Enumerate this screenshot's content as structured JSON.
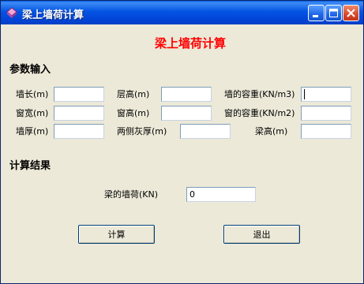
{
  "window": {
    "title": "梁上墙荷计算"
  },
  "heading": "梁上墙荷计算",
  "sections": {
    "input": "参数输入",
    "result": "计算结果"
  },
  "fields": [
    {
      "label": "墙长(m)",
      "value": ""
    },
    {
      "label": "层高(m)",
      "value": ""
    },
    {
      "label": "墙的容重(KN/m3)",
      "value": ""
    },
    {
      "label": "窗宽(m)",
      "value": ""
    },
    {
      "label": "窗高(m)",
      "value": ""
    },
    {
      "label": "窗的容重(KN/m2)",
      "value": ""
    },
    {
      "label": "墙厚(m)",
      "value": ""
    },
    {
      "label": "两侧灰厚(m)",
      "value": ""
    },
    {
      "label": "梁高(m)",
      "value": ""
    }
  ],
  "result": {
    "label": "梁的墙荷(KN)",
    "value": "0"
  },
  "buttons": {
    "calculate": "计算",
    "exit": "退出"
  },
  "icons": [
    "app-icon",
    "minimize-icon",
    "maximize-icon",
    "close-icon"
  ]
}
